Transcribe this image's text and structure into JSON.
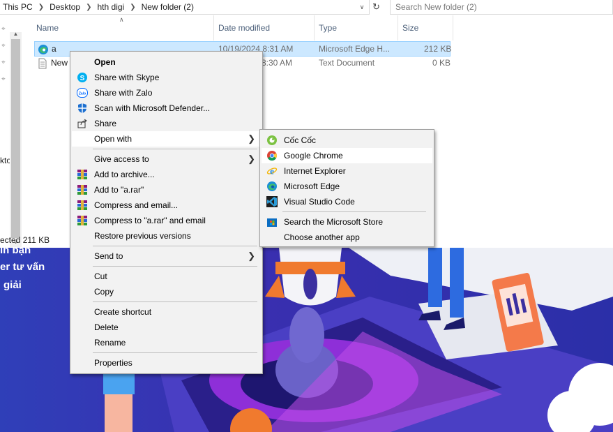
{
  "breadcrumb": [
    "This PC",
    "Desktop",
    "hth digi",
    "New folder (2)"
  ],
  "search_placeholder": "Search New folder (2)",
  "columns": {
    "name": "Name",
    "date": "Date modified",
    "type": "Type",
    "size": "Size"
  },
  "files": [
    {
      "name": "a",
      "date": "10/19/2024 8:31 AM",
      "type": "Microsoft Edge H...",
      "size": "212 KB",
      "icon": "edge-html-file-icon"
    },
    {
      "name": "New",
      "date": "8:30 AM",
      "type": "Text Document",
      "size": "0 KB",
      "icon": "text-file-icon"
    }
  ],
  "nav_partial_text": "kto",
  "status_text": "ected  211 KB",
  "wallpaper_text": [
    "ín bạn",
    "er tư vấn",
    "giải"
  ],
  "context_menu": [
    {
      "label": "Open",
      "icon": "",
      "bold": true
    },
    {
      "label": "Share with Skype",
      "icon": "skype-icon"
    },
    {
      "label": "Share with Zalo",
      "icon": "zalo-icon"
    },
    {
      "label": "Scan with Microsoft Defender...",
      "icon": "defender-shield-icon"
    },
    {
      "label": "Share",
      "icon": "share-icon"
    },
    {
      "label": "Open with",
      "icon": "",
      "submenu": true,
      "highlighted": true
    },
    {
      "label": "Give access to",
      "icon": "",
      "submenu": true
    },
    {
      "label": "Add to archive...",
      "icon": "winrar-icon"
    },
    {
      "label": "Add to \"a.rar\"",
      "icon": "winrar-icon"
    },
    {
      "label": "Compress and email...",
      "icon": "winrar-icon"
    },
    {
      "label": "Compress to \"a.rar\" and email",
      "icon": "winrar-icon"
    },
    {
      "label": "Restore previous versions",
      "icon": ""
    },
    {
      "label": "Send to",
      "icon": "",
      "submenu": true
    },
    {
      "label": "Cut",
      "icon": ""
    },
    {
      "label": "Copy",
      "icon": ""
    },
    {
      "label": "Create shortcut",
      "icon": ""
    },
    {
      "label": "Delete",
      "icon": ""
    },
    {
      "label": "Rename",
      "icon": ""
    },
    {
      "label": "Properties",
      "icon": ""
    }
  ],
  "open_with_menu": [
    {
      "label": "Cốc Cốc",
      "icon": "coccoc-icon"
    },
    {
      "label": "Google Chrome",
      "icon": "chrome-icon",
      "highlighted": true
    },
    {
      "label": "Internet Explorer",
      "icon": "internet-explorer-icon"
    },
    {
      "label": "Microsoft Edge",
      "icon": "edge-icon"
    },
    {
      "label": "Visual Studio Code",
      "icon": "vscode-icon"
    },
    {
      "label": "Search the Microsoft Store",
      "icon": "microsoft-store-icon"
    },
    {
      "label": "Choose another app",
      "icon": ""
    }
  ],
  "colors": {
    "selection": "#cce8ff",
    "selection_border": "#99d1ff",
    "menu_bg": "#f2f2f2",
    "wallpaper": "#2f3fb8"
  }
}
